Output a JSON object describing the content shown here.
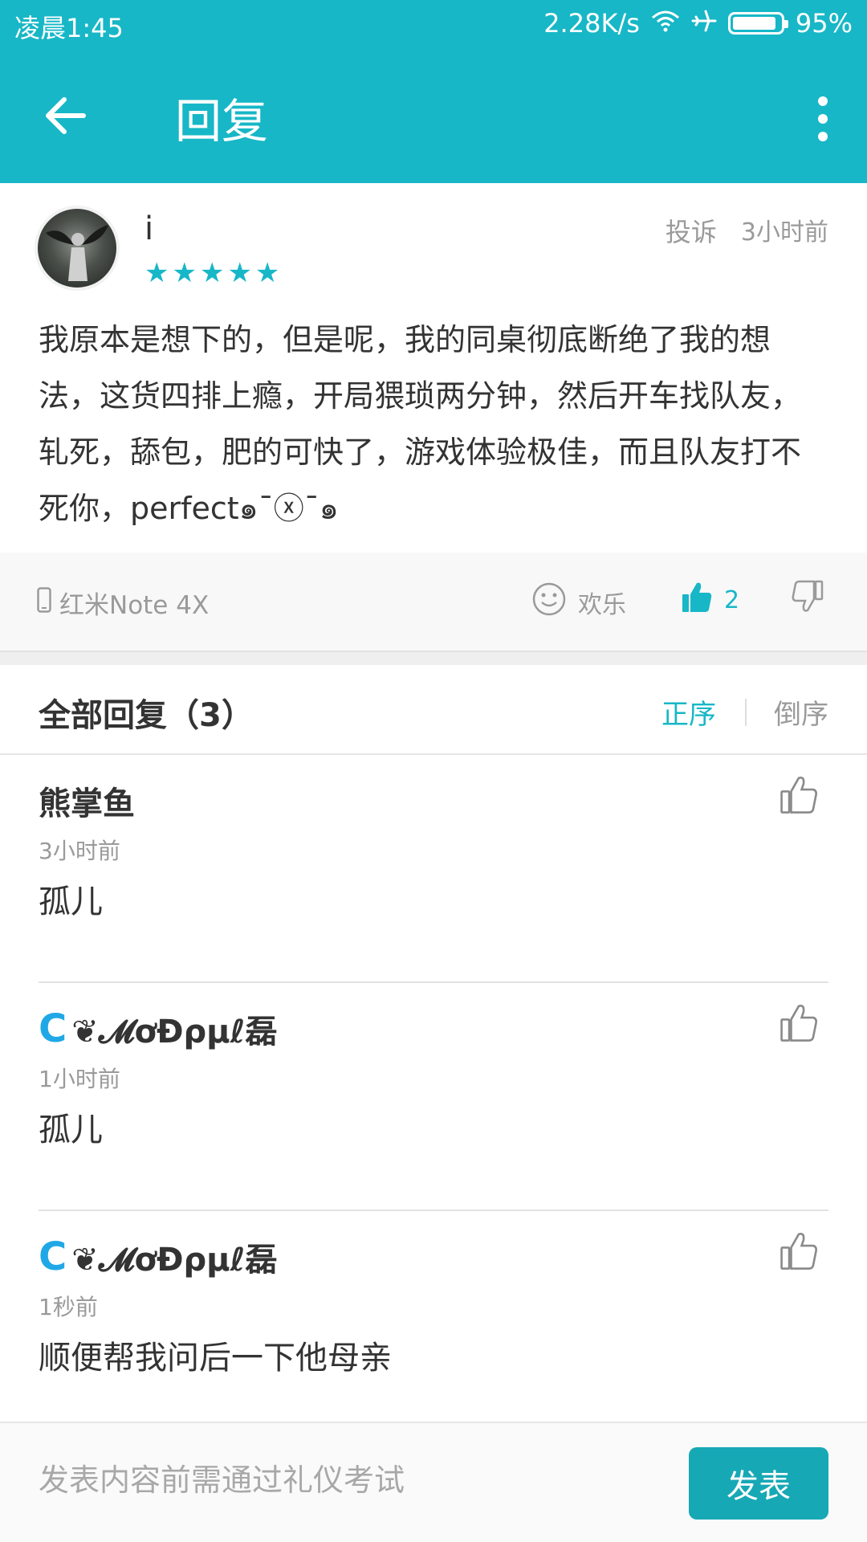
{
  "status_bar": {
    "time": "凌晨1:45",
    "speed": "2.28K/s",
    "battery": "95%",
    "battery_level": 0.95
  },
  "app_bar": {
    "title": "回复"
  },
  "post": {
    "username": "i",
    "rating": 5,
    "stars_text": "★★★★★",
    "report_label": "投诉",
    "time": "3小时前",
    "content": "我原本是想下的，但是呢，我的同桌彻底断绝了我的想法，这货四排上瘾，开局猥琐两分钟，然后开车找队友，轧死，舔包，肥的可快了，游戏体验极佳，而且队友打不死你，perfect๑¯ⓧ¯๑",
    "device": "红米Note 4X",
    "mood": "欢乐",
    "likes": "2"
  },
  "replies": {
    "header": "全部回复（3）",
    "order_asc": "正序",
    "order_desc": "倒序",
    "items": [
      {
        "name": "熊掌鱼",
        "time": "3小时前",
        "text": "孤儿",
        "badge": ""
      },
      {
        "name": "❦𝓜ơĐρµℓ磊",
        "time": "1小时前",
        "text": "孤儿",
        "badge": "C"
      },
      {
        "name": "❦𝓜ơĐρµℓ磊",
        "time": "1秒前",
        "text": "顺便帮我问后一下他母亲",
        "badge": "C"
      }
    ]
  },
  "composer": {
    "placeholder": "发表内容前需通过礼仪考试",
    "send_label": "发表"
  },
  "colors": {
    "accent": "#17b7c7",
    "send_button": "#17a8b5"
  }
}
